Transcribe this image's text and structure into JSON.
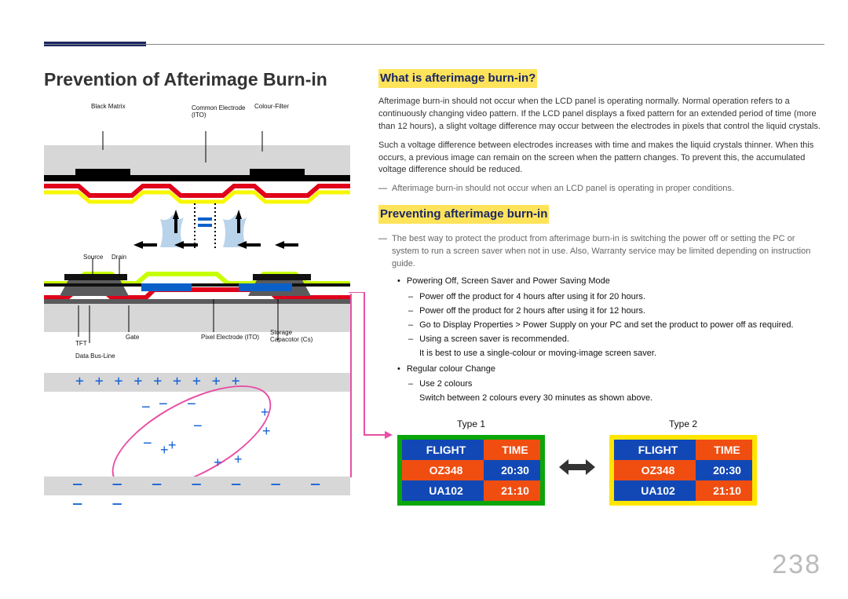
{
  "page_number": "238",
  "title": "Prevention of Afterimage Burn-in",
  "diagram_labels": {
    "black_matrix": "Black Matrix",
    "common_electrode": "Common Electrode (ITO)",
    "colour_filter": "Colour-Filter",
    "source": "Source",
    "drain": "Drain",
    "tft": "TFT",
    "gate": "Gate",
    "data_bus": "Data Bus-Line",
    "pixel_electrode": "Pixel Electrode (ITO)",
    "storage_cap": "Storage Capacotor (Cs)"
  },
  "section1": {
    "heading": "What is afterimage burn-in?",
    "p1": "Afterimage burn-in should not occur when the LCD panel is operating normally. Normal operation refers to a continuously changing video pattern. If the LCD panel displays a fixed pattern for an extended period of time (more than 12 hours), a slight voltage difference may occur between the electrodes in pixels that control the liquid crystals.",
    "p2": "Such a voltage difference between electrodes increases with time and makes the liquid crystals thinner. When this occurs, a previous image can remain on the screen when the pattern changes. To prevent this, the accumulated voltage difference should be reduced.",
    "note": "Afterimage burn-in should not occur when an LCD panel is operating in proper conditions."
  },
  "section2": {
    "heading": "Preventing afterimage burn-in",
    "lead": "The best way to protect the product from afterimage burn-in is switching the power off or setting the PC or system to run a screen saver when not in use. Also, Warranty service may be limited depending on instruction guide.",
    "bullet1": "Powering Off, Screen Saver and Power Saving Mode",
    "s1": "Power off the product for 4 hours after using it for 20 hours.",
    "s2": "Power off the product for 2 hours after using it for 12 hours.",
    "s3": "Go to Display Properties > Power Supply on your PC and set the product to power off as required.",
    "s4": "Using a screen saver is recommended.",
    "s4b": "It is best to use a single-colour or moving-image screen saver.",
    "bullet2": "Regular colour Change",
    "s5": "Use 2 colours",
    "s5b": "Switch between 2 colours every 30 minutes as shown above."
  },
  "types": {
    "t1": "Type 1",
    "t2": "Type 2"
  },
  "flight": {
    "hdr_flight": "FLIGHT",
    "hdr_time": "TIME",
    "r1a": "OZ348",
    "r1b": "20:30",
    "r2a": "UA102",
    "r2b": "21:10"
  }
}
